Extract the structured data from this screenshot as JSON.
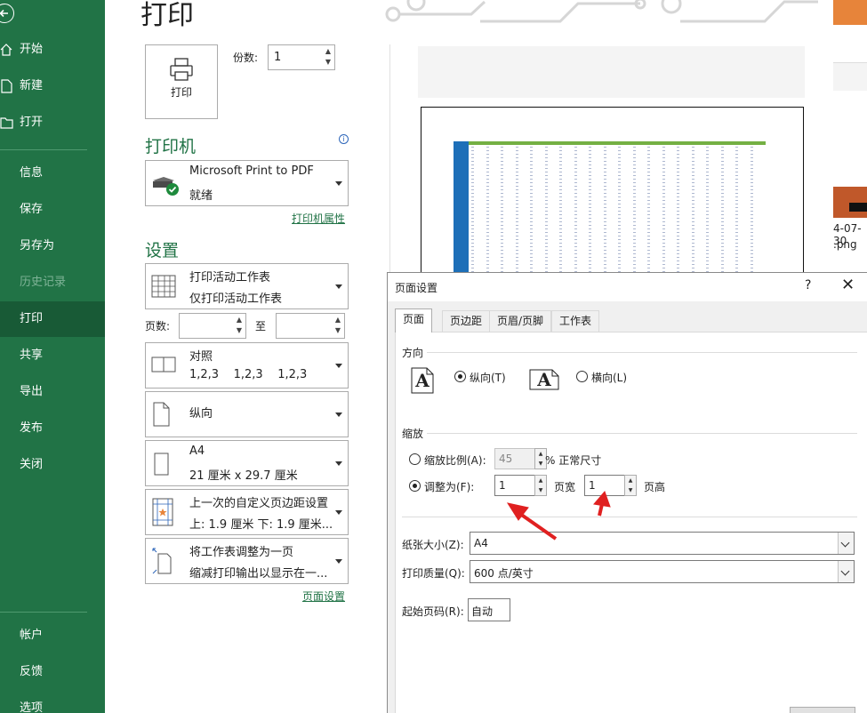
{
  "sidebar": {
    "items": [
      {
        "label": "开始",
        "icon": "home-icon"
      },
      {
        "label": "新建",
        "icon": "new-document-icon"
      },
      {
        "label": "打开",
        "icon": "folder-open-icon"
      },
      {
        "label": "信息"
      },
      {
        "label": "保存"
      },
      {
        "label": "另存为"
      },
      {
        "label": "历史记录"
      },
      {
        "label": "打印"
      },
      {
        "label": "共享"
      },
      {
        "label": "导出"
      },
      {
        "label": "发布"
      },
      {
        "label": "关闭"
      },
      {
        "label": "帐户"
      },
      {
        "label": "反馈"
      },
      {
        "label": "选项"
      }
    ]
  },
  "page": {
    "title": "打印"
  },
  "print": {
    "button_label": "打印",
    "copies_label": "份数:",
    "copies_value": "1"
  },
  "printer": {
    "heading": "打印机",
    "name": "Microsoft Print to PDF",
    "status": "就绪",
    "properties_link": "打印机属性"
  },
  "settings": {
    "heading": "设置",
    "scope": {
      "title": "打印活动工作表",
      "subtitle": "仅打印活动工作表"
    },
    "pages_label": "页数:",
    "to_label": "至",
    "collate": {
      "title": "对照",
      "subtitle": "1,2,3    1,2,3    1,2,3"
    },
    "orientation": {
      "title": "纵向"
    },
    "paper": {
      "title": "A4",
      "subtitle": "21 厘米 x 29.7 厘米"
    },
    "margins": {
      "title": "上一次的自定义页边距设置",
      "subtitle": "上: 1.9 厘米 下: 1.9 厘米..."
    },
    "scaling": {
      "title": "将工作表调整为一页",
      "subtitle": "缩减打印输出以显示在一..."
    },
    "page_setup_link": "页面设置"
  },
  "side_thumbs": {
    "date_text": "4-07-30",
    "ext_text": ".png"
  },
  "dialog": {
    "title": "页面设置",
    "help": "?",
    "close": "✕",
    "tabs": [
      "页面",
      "页边距",
      "页眉/页脚",
      "工作表"
    ],
    "orientation_group": "方向",
    "portrait_label": "纵向(T)",
    "landscape_label": "横向(L)",
    "orientation_icon_glyph": "A",
    "scaling_group": "缩放",
    "scale_label": "缩放比例(A):",
    "scale_value": "45",
    "scale_suffix": "% 正常尺寸",
    "fit_label": "调整为(F):",
    "fit_wide_value": "1",
    "fit_wide_suffix": "页宽",
    "fit_tall_value": "1",
    "fit_tall_suffix": "页高",
    "paper_size_label": "纸张大小(Z):",
    "paper_size_value": "A4",
    "print_quality_label": "打印质量(Q):",
    "print_quality_value": "600 点/英寸",
    "first_page_label": "起始页码(R):",
    "first_page_value": "自动"
  },
  "colors": {
    "accent": "#217346",
    "annotation_arrow": "#e02020"
  }
}
